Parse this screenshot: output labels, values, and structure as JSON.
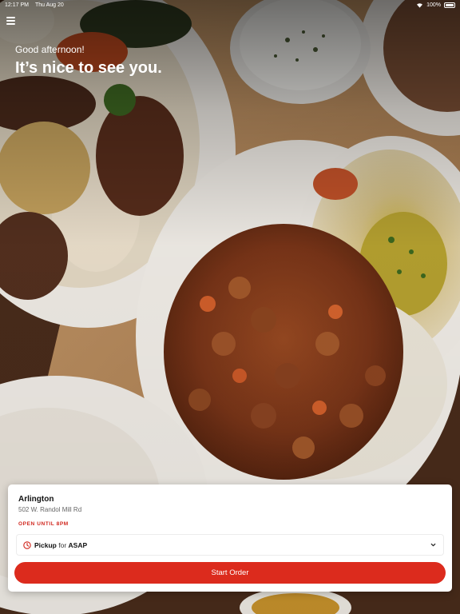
{
  "status_bar": {
    "time": "12:17 PM",
    "date": "Thu Aug 20",
    "battery": "100%"
  },
  "header": {
    "greeting": "Good afternoon!",
    "welcome": "It’s nice to see you."
  },
  "location": {
    "name": "Arlington",
    "address": "502 W. Randol Mill Rd",
    "hours": "OPEN UNTIL 8PM"
  },
  "order": {
    "mode": "Pickup",
    "for_label": "for",
    "time": "ASAP",
    "start_label": "Start Order"
  },
  "colors": {
    "accent": "#dc2b1d",
    "hours_text": "#d0251c"
  },
  "icons": {
    "menu": "hamburger-menu-icon",
    "clock": "clock-icon",
    "chevron": "chevron-down-icon"
  }
}
